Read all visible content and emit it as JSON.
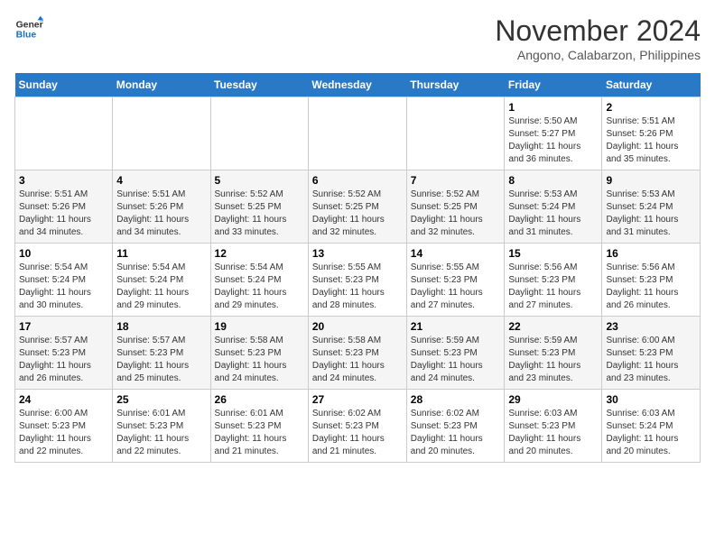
{
  "header": {
    "logo_line1": "General",
    "logo_line2": "Blue",
    "month": "November 2024",
    "location": "Angono, Calabarzon, Philippines"
  },
  "weekdays": [
    "Sunday",
    "Monday",
    "Tuesday",
    "Wednesday",
    "Thursday",
    "Friday",
    "Saturday"
  ],
  "weeks": [
    [
      {
        "day": "",
        "info": ""
      },
      {
        "day": "",
        "info": ""
      },
      {
        "day": "",
        "info": ""
      },
      {
        "day": "",
        "info": ""
      },
      {
        "day": "",
        "info": ""
      },
      {
        "day": "1",
        "info": "Sunrise: 5:50 AM\nSunset: 5:27 PM\nDaylight: 11 hours\nand 36 minutes."
      },
      {
        "day": "2",
        "info": "Sunrise: 5:51 AM\nSunset: 5:26 PM\nDaylight: 11 hours\nand 35 minutes."
      }
    ],
    [
      {
        "day": "3",
        "info": "Sunrise: 5:51 AM\nSunset: 5:26 PM\nDaylight: 11 hours\nand 34 minutes."
      },
      {
        "day": "4",
        "info": "Sunrise: 5:51 AM\nSunset: 5:26 PM\nDaylight: 11 hours\nand 34 minutes."
      },
      {
        "day": "5",
        "info": "Sunrise: 5:52 AM\nSunset: 5:25 PM\nDaylight: 11 hours\nand 33 minutes."
      },
      {
        "day": "6",
        "info": "Sunrise: 5:52 AM\nSunset: 5:25 PM\nDaylight: 11 hours\nand 32 minutes."
      },
      {
        "day": "7",
        "info": "Sunrise: 5:52 AM\nSunset: 5:25 PM\nDaylight: 11 hours\nand 32 minutes."
      },
      {
        "day": "8",
        "info": "Sunrise: 5:53 AM\nSunset: 5:24 PM\nDaylight: 11 hours\nand 31 minutes."
      },
      {
        "day": "9",
        "info": "Sunrise: 5:53 AM\nSunset: 5:24 PM\nDaylight: 11 hours\nand 31 minutes."
      }
    ],
    [
      {
        "day": "10",
        "info": "Sunrise: 5:54 AM\nSunset: 5:24 PM\nDaylight: 11 hours\nand 30 minutes."
      },
      {
        "day": "11",
        "info": "Sunrise: 5:54 AM\nSunset: 5:24 PM\nDaylight: 11 hours\nand 29 minutes."
      },
      {
        "day": "12",
        "info": "Sunrise: 5:54 AM\nSunset: 5:24 PM\nDaylight: 11 hours\nand 29 minutes."
      },
      {
        "day": "13",
        "info": "Sunrise: 5:55 AM\nSunset: 5:23 PM\nDaylight: 11 hours\nand 28 minutes."
      },
      {
        "day": "14",
        "info": "Sunrise: 5:55 AM\nSunset: 5:23 PM\nDaylight: 11 hours\nand 27 minutes."
      },
      {
        "day": "15",
        "info": "Sunrise: 5:56 AM\nSunset: 5:23 PM\nDaylight: 11 hours\nand 27 minutes."
      },
      {
        "day": "16",
        "info": "Sunrise: 5:56 AM\nSunset: 5:23 PM\nDaylight: 11 hours\nand 26 minutes."
      }
    ],
    [
      {
        "day": "17",
        "info": "Sunrise: 5:57 AM\nSunset: 5:23 PM\nDaylight: 11 hours\nand 26 minutes."
      },
      {
        "day": "18",
        "info": "Sunrise: 5:57 AM\nSunset: 5:23 PM\nDaylight: 11 hours\nand 25 minutes."
      },
      {
        "day": "19",
        "info": "Sunrise: 5:58 AM\nSunset: 5:23 PM\nDaylight: 11 hours\nand 24 minutes."
      },
      {
        "day": "20",
        "info": "Sunrise: 5:58 AM\nSunset: 5:23 PM\nDaylight: 11 hours\nand 24 minutes."
      },
      {
        "day": "21",
        "info": "Sunrise: 5:59 AM\nSunset: 5:23 PM\nDaylight: 11 hours\nand 24 minutes."
      },
      {
        "day": "22",
        "info": "Sunrise: 5:59 AM\nSunset: 5:23 PM\nDaylight: 11 hours\nand 23 minutes."
      },
      {
        "day": "23",
        "info": "Sunrise: 6:00 AM\nSunset: 5:23 PM\nDaylight: 11 hours\nand 23 minutes."
      }
    ],
    [
      {
        "day": "24",
        "info": "Sunrise: 6:00 AM\nSunset: 5:23 PM\nDaylight: 11 hours\nand 22 minutes."
      },
      {
        "day": "25",
        "info": "Sunrise: 6:01 AM\nSunset: 5:23 PM\nDaylight: 11 hours\nand 22 minutes."
      },
      {
        "day": "26",
        "info": "Sunrise: 6:01 AM\nSunset: 5:23 PM\nDaylight: 11 hours\nand 21 minutes."
      },
      {
        "day": "27",
        "info": "Sunrise: 6:02 AM\nSunset: 5:23 PM\nDaylight: 11 hours\nand 21 minutes."
      },
      {
        "day": "28",
        "info": "Sunrise: 6:02 AM\nSunset: 5:23 PM\nDaylight: 11 hours\nand 20 minutes."
      },
      {
        "day": "29",
        "info": "Sunrise: 6:03 AM\nSunset: 5:23 PM\nDaylight: 11 hours\nand 20 minutes."
      },
      {
        "day": "30",
        "info": "Sunrise: 6:03 AM\nSunset: 5:24 PM\nDaylight: 11 hours\nand 20 minutes."
      }
    ]
  ]
}
